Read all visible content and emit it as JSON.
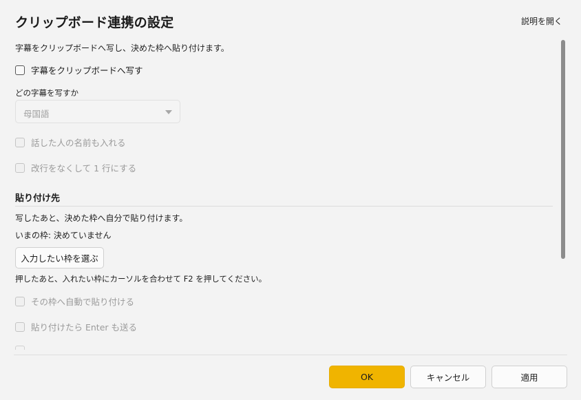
{
  "dialog": {
    "title": "クリップボード連携の設定",
    "help_link": "説明を開く"
  },
  "copy_section": {
    "description": "字幕をクリップボードへ写し、決めた枠へ貼り付けます。",
    "enable_checkbox": {
      "label": "字幕をクリップボードへ写す",
      "checked": false
    },
    "which_label": "どの字幕を写すか",
    "which_select": {
      "value": "母国語",
      "enabled": false
    },
    "include_speaker": {
      "label": "話した人の名前も入れる",
      "checked": false,
      "enabled": false
    },
    "single_line": {
      "label": "改行をなくして 1 行にする",
      "checked": false,
      "enabled": false
    }
  },
  "paste_section": {
    "title": "貼り付け先",
    "description": "写したあと、決めた枠へ自分で貼り付けます。",
    "current_target": "いまの枠: 決めていません",
    "pick_button": "入力したい枠を選ぶ",
    "hint": "押したあと、入れたい枠にカーソルを合わせて F2 を押してください。",
    "auto_paste": {
      "label": "その枠へ自動で貼り付ける",
      "checked": false,
      "enabled": false
    },
    "send_enter": {
      "label": "貼り付けたら Enter も送る",
      "checked": false,
      "enabled": false
    }
  },
  "footer": {
    "ok": "OK",
    "cancel": "キャンセル",
    "apply": "適用"
  },
  "colors": {
    "background": "#f3f3f3",
    "accent": "#f0b400",
    "disabled_text": "#9a9a9a"
  }
}
